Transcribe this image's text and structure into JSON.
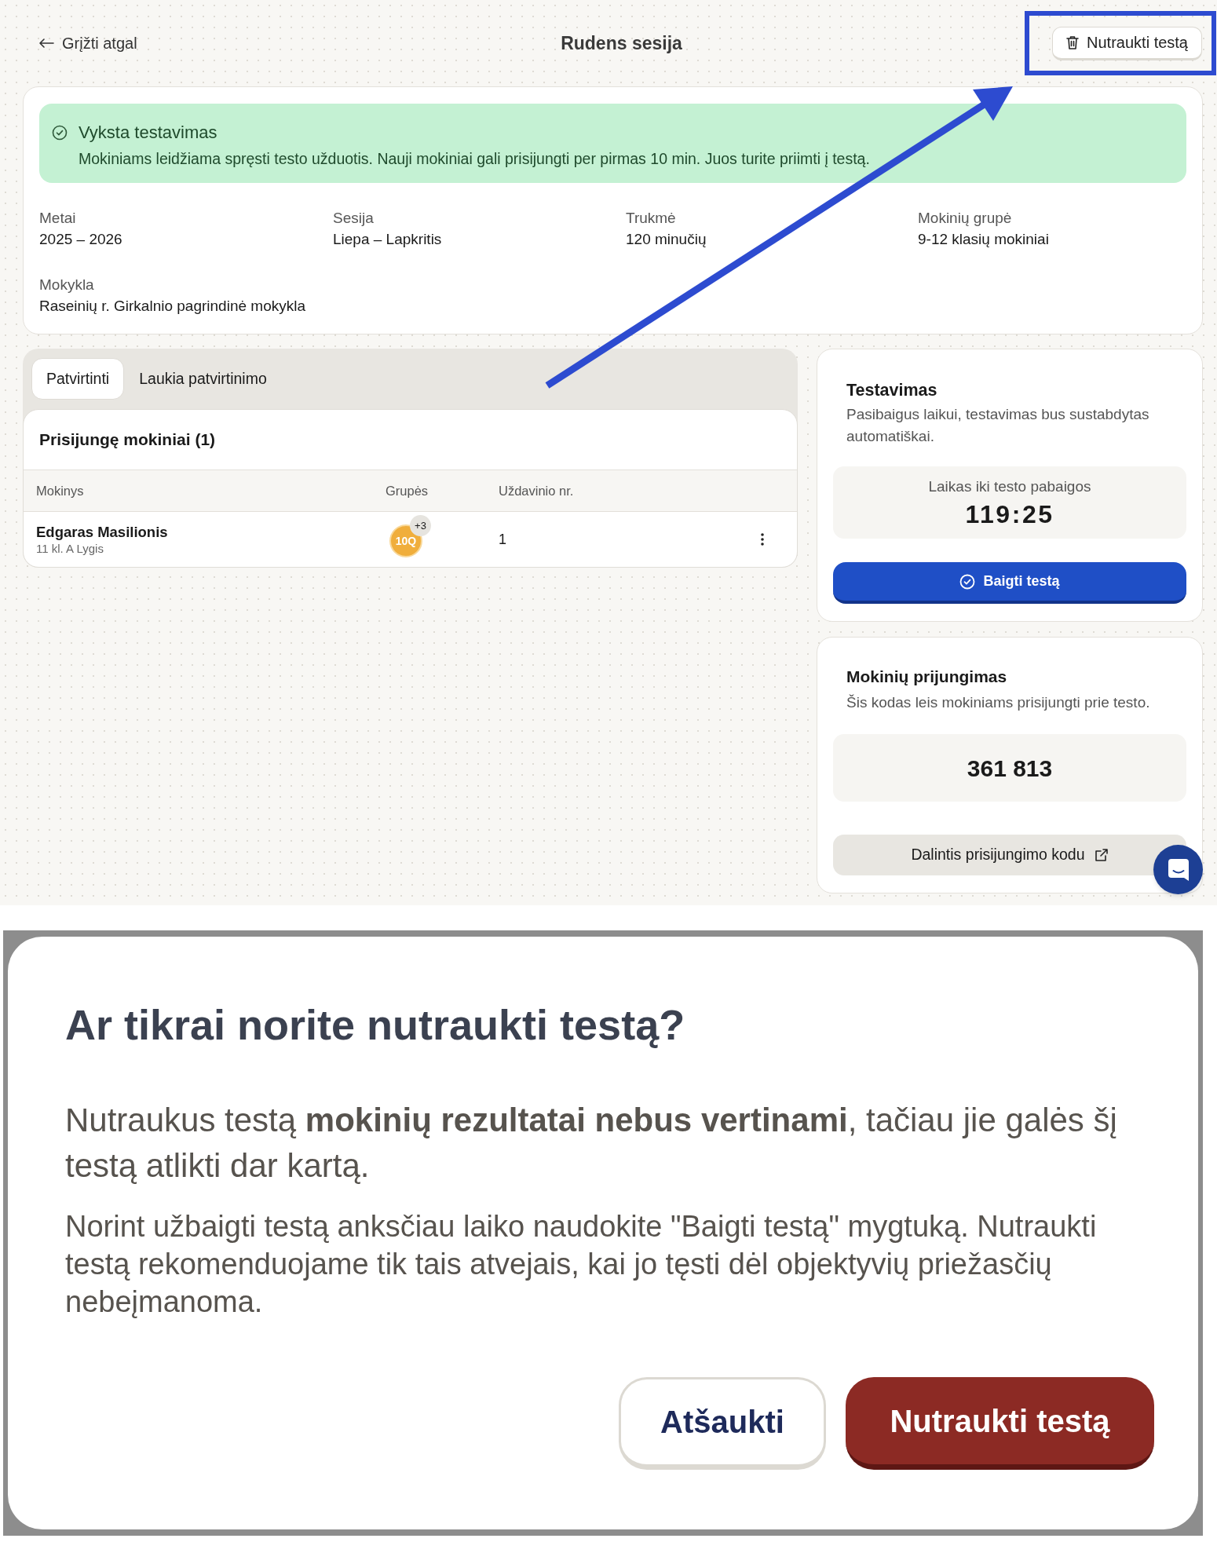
{
  "header": {
    "back_link": "Grįžti atgal",
    "title": "Rudens sesija",
    "cancel_button": "Nutraukti testą"
  },
  "status_banner": {
    "title": "Vyksta testavimas",
    "text": "Mokiniams leidžiama spręsti testo užduotis. Nauji mokiniai gali prisijungti per pirmas 10 min. Juos turite priimti į testą."
  },
  "details": [
    {
      "label": "Metai",
      "value": "2025 – 2026"
    },
    {
      "label": "Sesija",
      "value": "Liepa – Lapkritis"
    },
    {
      "label": "Trukmė",
      "value": "120 minučių"
    },
    {
      "label": "Mokinių grupė",
      "value": "9-12 klasių mokiniai"
    },
    {
      "label": "Mokykla",
      "value": "Raseinių r. Girkalnio pagrindinė mokykla"
    }
  ],
  "students_panel": {
    "tabs": [
      {
        "label": "Patvirtinti",
        "selected": true
      },
      {
        "label": "Laukia patvirtinimo",
        "selected": false
      }
    ],
    "title": "Prisijungę mokiniai (1)",
    "columns": [
      "Mokinys",
      "Grupės",
      "Uždavinio nr."
    ],
    "rows": [
      {
        "name": "Edgaras Masilionis",
        "details": "11 kl. A Lygis",
        "group": "10Q",
        "group_more": "+3",
        "task": "1"
      }
    ]
  },
  "testing_card": {
    "title": "Testavimas",
    "description": "Pasibaigus laikui, testavimas bus sustabdytas automatiškai.",
    "timer_label": "Laikas iki testo pabaigos",
    "timer": "119:25",
    "finish_button": "Baigti testą"
  },
  "join_card": {
    "title": "Mokinių prijungimas",
    "description": "Šis kodas leis mokiniams prisijungti prie testo.",
    "code": "361 813",
    "share_button": "Dalintis prisijungimo kodu"
  },
  "dialog": {
    "title": "Ar tikrai norite nutraukti testą?",
    "paragraphs": [
      "Nutraukus testą **mokinių rezultatai nebus vertinami**, tačiau jie galės šį testą atlikti dar kartą.",
      "Norint užbaigti testą anksčiau laiko naudokite \"Baigti testą\" mygtuką. Nutraukti testą rekomenduojame tik tais atvejais, kai jo tęsti dėl objektyvių priežasčių nebeįmanoma."
    ],
    "buttons": [
      {
        "label": "Atšaukti",
        "kind": "secondary"
      },
      {
        "label": "Nutraukti testą",
        "kind": "danger"
      }
    ]
  }
}
